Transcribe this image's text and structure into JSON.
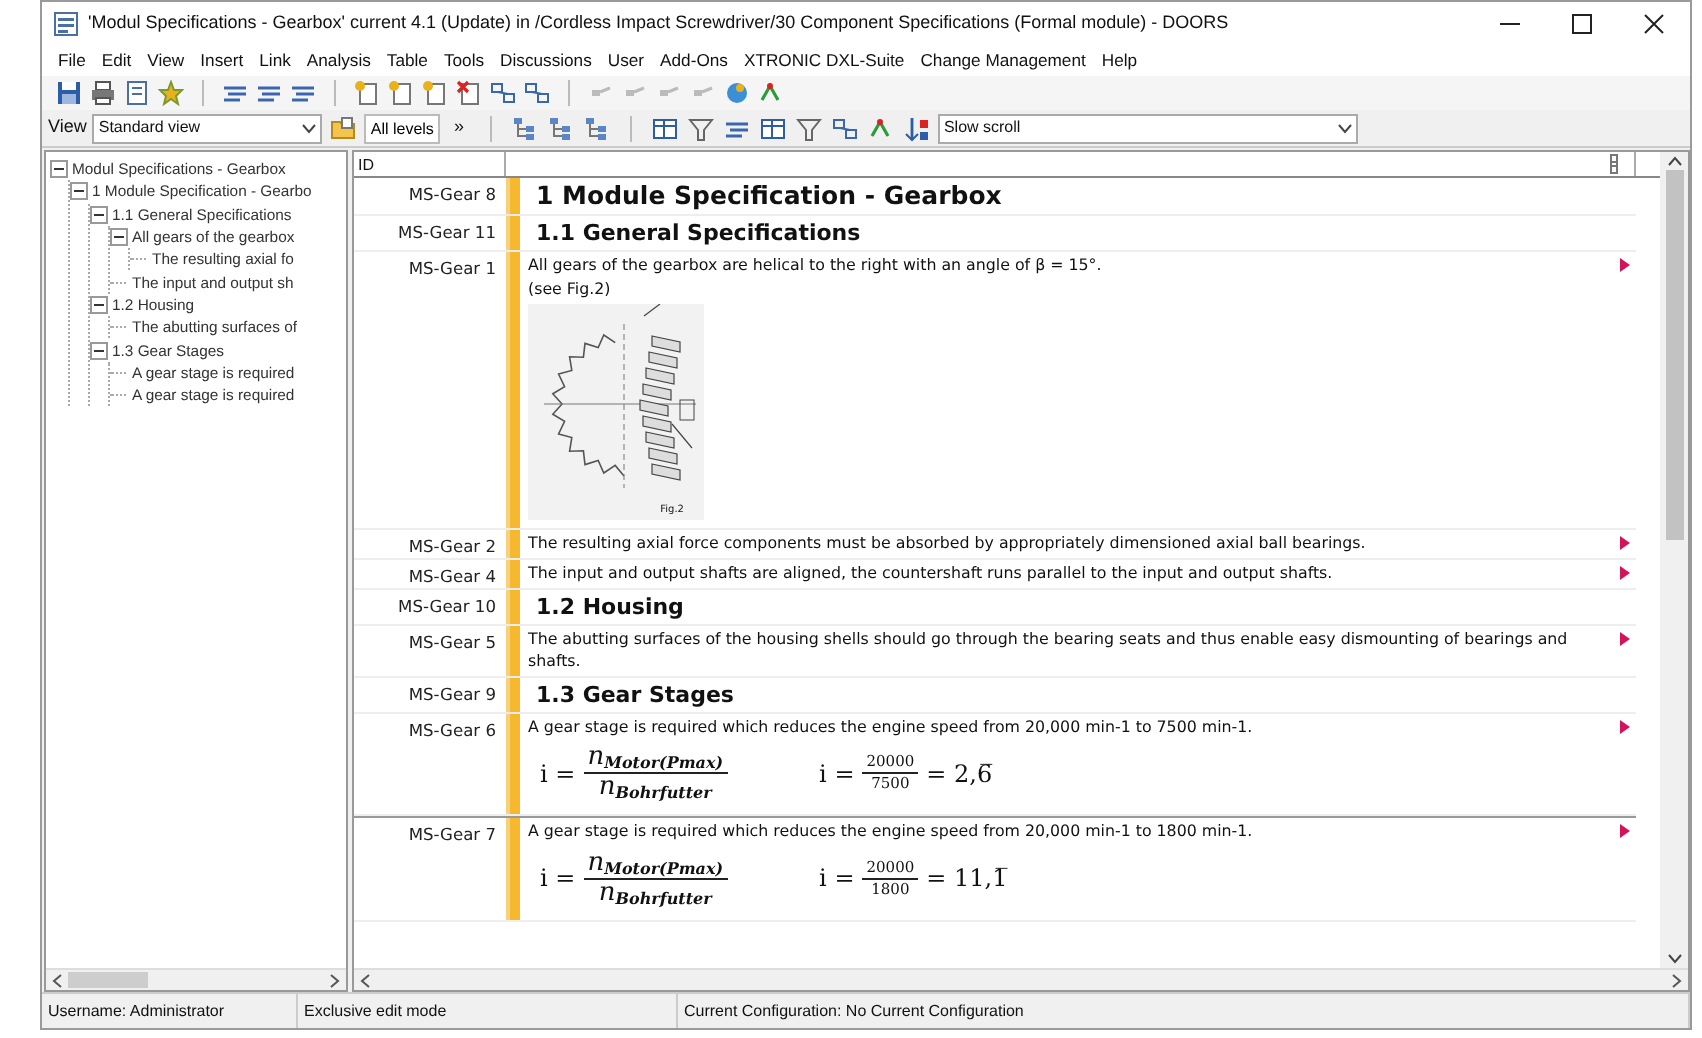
{
  "window": {
    "title": "'Modul Specifications - Gearbox' current 4.1 (Update) in /Cordless Impact Screwdriver/30 Component Specifications (Formal module) - DOORS"
  },
  "menu": [
    "File",
    "Edit",
    "View",
    "Insert",
    "Link",
    "Analysis",
    "Table",
    "Tools",
    "Discussions",
    "User",
    "Add-Ons",
    "XTRONIC DXL-Suite",
    "Change Management",
    "Help"
  ],
  "toolbar": {
    "view_label": "View",
    "view_value": "Standard view",
    "levels": "All levels",
    "overflow": "»",
    "scroll_value": "Slow scroll"
  },
  "tree": [
    {
      "label": "Modul Specifications - Gearbox",
      "expanded": true,
      "children": [
        {
          "label": "1 Module Specification - Gearbo",
          "expanded": true,
          "children": [
            {
              "label": "1.1 General Specifications",
              "expanded": true,
              "children": [
                {
                  "label": "All gears of the gearbox",
                  "expanded": true,
                  "children": [
                    {
                      "label": "The resulting axial fo"
                    }
                  ]
                },
                {
                  "label": "The input and output sh"
                }
              ]
            },
            {
              "label": "1.2 Housing",
              "expanded": true,
              "children": [
                {
                  "label": "The abutting surfaces of"
                }
              ]
            },
            {
              "label": "1.3 Gear Stages",
              "expanded": true,
              "children": [
                {
                  "label": "A gear stage is required"
                },
                {
                  "label": "A gear stage is required"
                }
              ]
            }
          ]
        }
      ]
    }
  ],
  "table": {
    "columns": [
      "ID"
    ],
    "rows": [
      {
        "id": "MS-Gear 8",
        "kind": "heading1",
        "text": "1 Module Specification - Gearbox",
        "marked": false
      },
      {
        "id": "MS-Gear 11",
        "kind": "heading2",
        "text": "1.1 General Specifications",
        "marked": false
      },
      {
        "id": "MS-Gear 1",
        "kind": "text",
        "text": "All gears of the gearbox are helical to the right with an angle of β = 15°.",
        "note": "(see Fig.2)",
        "figure": {
          "caption": "Fig.2"
        },
        "marked": true
      },
      {
        "id": "MS-Gear 2",
        "kind": "text",
        "text": "The resulting axial force components must be absorbed by appropriately dimensioned axial ball bearings.",
        "marked": true
      },
      {
        "id": "MS-Gear 4",
        "kind": "text",
        "text": "The input and output shafts are aligned, the countershaft runs parallel to the input and output shafts.",
        "marked": true
      },
      {
        "id": "MS-Gear 10",
        "kind": "heading2",
        "text": "1.2 Housing",
        "marked": false
      },
      {
        "id": "MS-Gear 5",
        "kind": "text",
        "text": "The abutting surfaces of the housing shells should go through the bearing seats and thus enable easy dismounting of bearings and shafts.",
        "marked": true
      },
      {
        "id": "MS-Gear 9",
        "kind": "heading2",
        "text": "1.3 Gear Stages",
        "marked": false
      },
      {
        "id": "MS-Gear 6",
        "kind": "text",
        "text": "A gear stage is required which reduces the engine speed from 20,000 min-1 to 7500 min-1.",
        "formulas": [
          {
            "lhs": "i =",
            "num": "n$_{Motor(Pmax)}$",
            "den": "n$_{Bohrfutter}$"
          },
          {
            "lhs": "i =",
            "num": "20000",
            "den": "7500",
            "rhs": "= 2,6̅"
          }
        ],
        "marked": true
      },
      {
        "id": "MS-Gear 7",
        "kind": "text",
        "text": "A gear stage is required which reduces the engine speed from 20,000 min-1 to 1800 min-1.",
        "formulas": [
          {
            "lhs": "i =",
            "num": "n$_{Motor(Pmax)}$",
            "den": "n$_{Bohrfutter}$"
          },
          {
            "lhs": "i =",
            "num": "20000",
            "den": "1800",
            "rhs": "= 11,1̅"
          }
        ],
        "marked": true
      }
    ]
  },
  "status_bar": [
    "Username: Administrator",
    "Exclusive edit mode",
    "Current Configuration: No Current Configuration"
  ]
}
